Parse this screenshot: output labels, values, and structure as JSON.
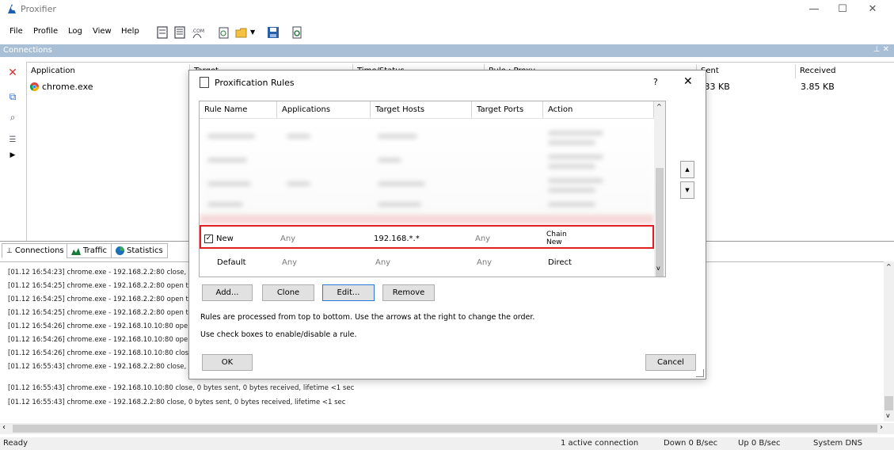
{
  "app": {
    "title": "Proxifier"
  },
  "menu": [
    "File",
    "Profile",
    "Log",
    "View",
    "Help"
  ],
  "connections_panel": {
    "title": "Connections",
    "columns": [
      "Application",
      "Target",
      "Time/Status",
      "Rule : Proxy",
      "Sent",
      "Received"
    ],
    "row": {
      "application": "chrome.exe",
      "sent": ".33 KB",
      "received": "3.85 KB"
    }
  },
  "tabs": [
    "Connections",
    "Traffic",
    "Statistics"
  ],
  "log": [
    "[01.12 16:54:23] chrome.exe - 192.168.2.2:80 close, 27",
    "[01.12 16:54:25] chrome.exe - 192.168.2.2:80 open thr",
    "[01.12 16:54:25] chrome.exe - 192.168.2.2:80 open thr",
    "[01.12 16:54:25] chrome.exe - 192.168.2.2:80 open thr",
    "[01.12 16:54:26] chrome.exe - 192.168.10.10:80 open t",
    "[01.12 16:54:26] chrome.exe - 192.168.10.10:80 open t",
    "[01.12 16:54:26] chrome.exe - 192.168.10.10:80 close,",
    "[01.12 16:55:43] chrome.exe - 192.168.2.2:80 close, 0 b",
    "[01.12 16:55:43] chrome.exe - 192.168.10.10:80 close, 0 bytes sent, 0 bytes received, lifetime <1 sec",
    "[01.12 16:55:43] chrome.exe - 192.168.2.2:80 close, 0 bytes sent, 0 bytes received, lifetime <1 sec"
  ],
  "status": {
    "ready": "Ready",
    "active": "1 active connection",
    "down": "Down 0 B/sec",
    "up": "Up 0 B/sec",
    "dns": "System DNS"
  },
  "dialog": {
    "title": "Proxification Rules",
    "help": "?",
    "close": "✕",
    "columns": [
      "Rule Name",
      "Applications",
      "Target Hosts",
      "Target Ports",
      "Action"
    ],
    "rules": [
      {
        "name": "New",
        "checked": true,
        "applications": "Any",
        "hosts": "192.168.*.*",
        "ports": "Any",
        "action1": "Chain",
        "action2": "New"
      },
      {
        "name": "Default",
        "applications": "Any",
        "hosts": "Any",
        "ports": "Any",
        "action1": "Direct"
      }
    ],
    "buttons": {
      "add": "Add...",
      "clone": "Clone",
      "edit": "Edit...",
      "remove": "Remove",
      "ok": "OK",
      "cancel": "Cancel"
    },
    "note1": "Rules are processed from top to bottom. Use the arrows at the right to change the order.",
    "note2": "Use check boxes to enable/disable a rule."
  }
}
